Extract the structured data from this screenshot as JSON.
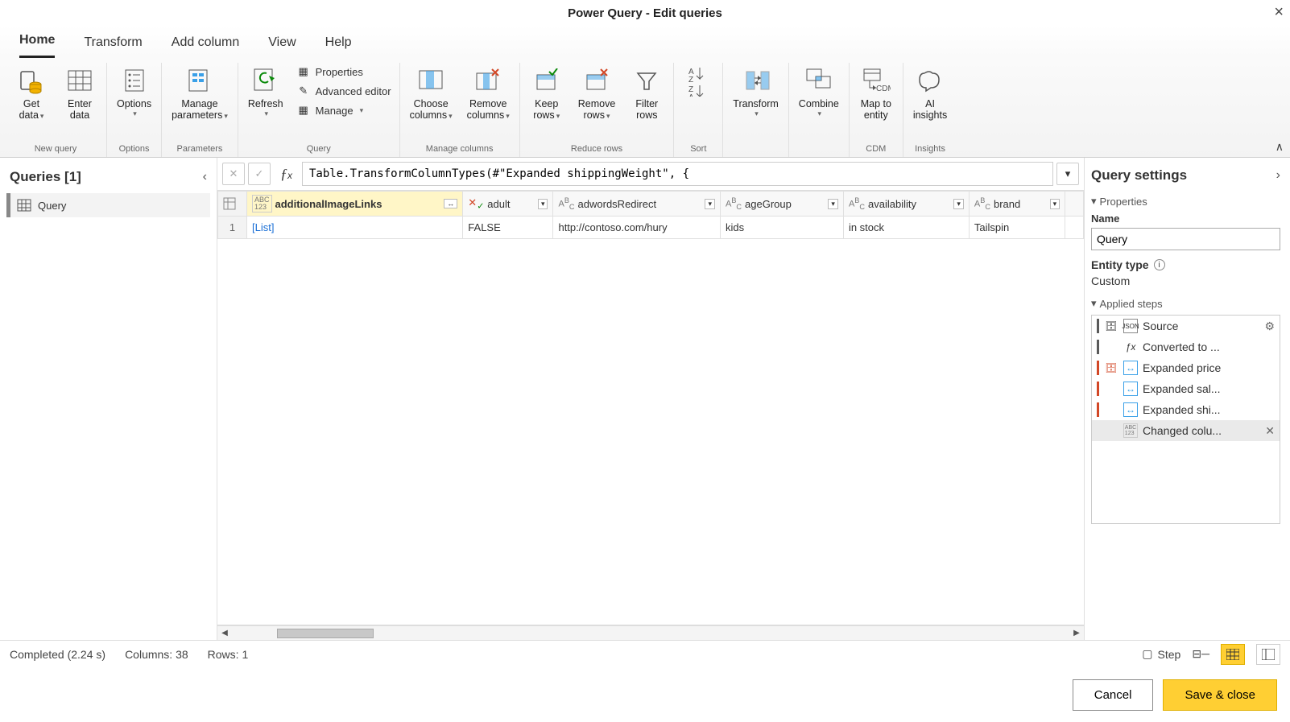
{
  "window": {
    "title": "Power Query - Edit queries"
  },
  "tabs": [
    "Home",
    "Transform",
    "Add column",
    "View",
    "Help"
  ],
  "activeTab": "Home",
  "ribbon": {
    "groups": [
      {
        "label": "New query",
        "items": [
          {
            "label1": "Get",
            "label2": "data",
            "drop": true,
            "icon": "database"
          },
          {
            "label1": "Enter",
            "label2": "data",
            "drop": false,
            "icon": "table"
          }
        ]
      },
      {
        "label": "Options",
        "items": [
          {
            "label1": "Options",
            "label2": "",
            "drop": true,
            "icon": "list"
          }
        ]
      },
      {
        "label": "Parameters",
        "items": [
          {
            "label1": "Manage",
            "label2": "parameters",
            "drop": true,
            "icon": "params"
          }
        ]
      },
      {
        "label": "Query",
        "items": [
          {
            "label1": "Refresh",
            "label2": "",
            "drop": true,
            "icon": "refresh"
          }
        ],
        "small": [
          {
            "label": "Properties",
            "icon": "props",
            "drop": false
          },
          {
            "label": "Advanced editor",
            "icon": "adv",
            "drop": false
          },
          {
            "label": "Manage",
            "icon": "manage",
            "drop": true
          }
        ]
      },
      {
        "label": "Manage columns",
        "items": [
          {
            "label1": "Choose",
            "label2": "columns",
            "drop": true,
            "icon": "choose"
          },
          {
            "label1": "Remove",
            "label2": "columns",
            "drop": true,
            "icon": "removecol"
          }
        ]
      },
      {
        "label": "Reduce rows",
        "items": [
          {
            "label1": "Keep",
            "label2": "rows",
            "drop": true,
            "icon": "keep"
          },
          {
            "label1": "Remove",
            "label2": "rows",
            "drop": true,
            "icon": "removerow"
          },
          {
            "label1": "Filter",
            "label2": "rows",
            "drop": false,
            "icon": "filter"
          }
        ]
      },
      {
        "label": "Sort",
        "items": [
          {
            "label1": "",
            "label2": "",
            "drop": false,
            "icon": "sort"
          }
        ]
      },
      {
        "label": "",
        "items": [
          {
            "label1": "Transform",
            "label2": "",
            "drop": true,
            "icon": "transform"
          }
        ]
      },
      {
        "label": "",
        "items": [
          {
            "label1": "Combine",
            "label2": "",
            "drop": true,
            "icon": "combine"
          }
        ]
      },
      {
        "label": "CDM",
        "items": [
          {
            "label1": "Map to",
            "label2": "entity",
            "drop": false,
            "icon": "cdm"
          }
        ]
      },
      {
        "label": "Insights",
        "items": [
          {
            "label1": "AI",
            "label2": "insights",
            "drop": false,
            "icon": "ai"
          }
        ]
      }
    ]
  },
  "queriesPane": {
    "heading": "Queries [1]",
    "items": [
      "Query"
    ]
  },
  "formula": "Table.TransformColumnTypes(#\"Expanded shippingWeight\", {",
  "columns": [
    {
      "name": "additionalImageLinks",
      "type": "ABC123",
      "selected": true,
      "expand": true
    },
    {
      "name": "adult",
      "type": "bool"
    },
    {
      "name": "adwordsRedirect",
      "type": "text"
    },
    {
      "name": "ageGroup",
      "type": "text"
    },
    {
      "name": "availability",
      "type": "text"
    },
    {
      "name": "brand",
      "type": "text"
    }
  ],
  "rows": [
    {
      "num": 1,
      "cells": [
        "[List]",
        "FALSE",
        "http://contoso.com/hury",
        "kids",
        "in stock",
        "Tailspin"
      ]
    }
  ],
  "settings": {
    "heading": "Query settings",
    "propsTitle": "Properties",
    "nameLabel": "Name",
    "nameValue": "Query",
    "entityLabel": "Entity type",
    "entityValue": "Custom",
    "stepsTitle": "Applied steps",
    "steps": [
      {
        "label": "Source",
        "icon": "json",
        "gear": true,
        "bar": "#5a5a5a"
      },
      {
        "label": "Converted to ...",
        "icon": "fx",
        "bar": "#5a5a5a"
      },
      {
        "label": "Expanded price",
        "icon": "expand",
        "bar": "#d24726"
      },
      {
        "label": "Expanded sal...",
        "icon": "expand",
        "bar": "#d24726"
      },
      {
        "label": "Expanded shi...",
        "icon": "expand",
        "bar": "#d24726"
      },
      {
        "label": "Changed colu...",
        "icon": "ABC123",
        "selected": true,
        "x": true
      }
    ]
  },
  "status": {
    "completed": "Completed (2.24 s)",
    "columns": "Columns: 38",
    "rows": "Rows: 1",
    "step": "Step"
  },
  "footer": {
    "cancel": "Cancel",
    "save": "Save & close"
  }
}
